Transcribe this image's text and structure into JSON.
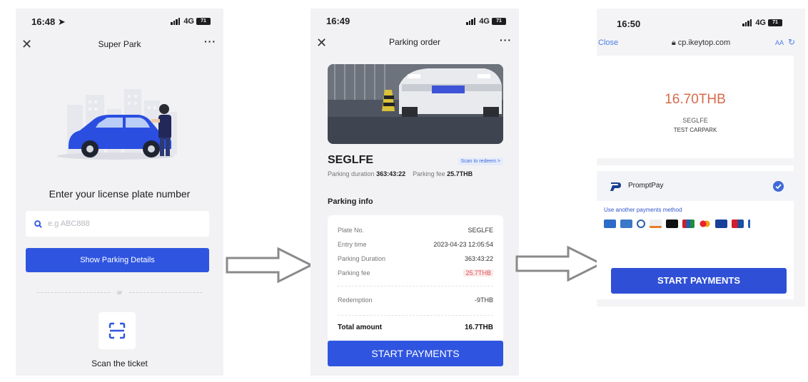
{
  "screen1": {
    "time": "16:48",
    "network": "4G",
    "battery": "71",
    "nav_title": "Super Park",
    "heading": "Enter your license plate number",
    "search_placeholder": "e.g ABC888",
    "button_label": "Show Parking Details",
    "or_label": "or",
    "scan_label": "Scan the ticket"
  },
  "screen2": {
    "time": "16:49",
    "network": "4G",
    "battery": "71",
    "nav_title": "Parking order",
    "plate": "SEGLFE",
    "redeem_label": "Scan to redeem >",
    "duration_label": "Parking duration",
    "duration_value": "363:43:22",
    "fee_label": "Parking fee",
    "fee_value": "25.7THB",
    "info_heading": "Parking info",
    "rows": [
      {
        "label": "Plate No.",
        "value": "SEGLFE"
      },
      {
        "label": "Entry time",
        "value": "2023-04-23 12:05:54"
      },
      {
        "label": "Parking Duration",
        "value": "363:43:22"
      },
      {
        "label": "Parking fee",
        "value": "25.7THB"
      },
      {
        "label": "Redemption",
        "value": "-9THB"
      },
      {
        "label": "Total amount",
        "value": "16.7THB"
      }
    ],
    "button_label": "START PAYMENTS"
  },
  "screen3": {
    "time": "16:50",
    "network": "4G",
    "battery": "71",
    "close_label": "Close",
    "url": "cp.ikeytop.com",
    "text_size_label": "AA",
    "amount": "16.70THB",
    "plate": "SEGLFE",
    "carpark": "TEST CARPARK",
    "payment_method": "PromptPay",
    "another_method": "Use another payments method",
    "button_label": "START PAYMENTS"
  },
  "colors": {
    "primary_button": "#2f55e0",
    "amount_text": "#d86a4a",
    "fee_highlight": "#d85555",
    "link": "#4a7ee6"
  }
}
